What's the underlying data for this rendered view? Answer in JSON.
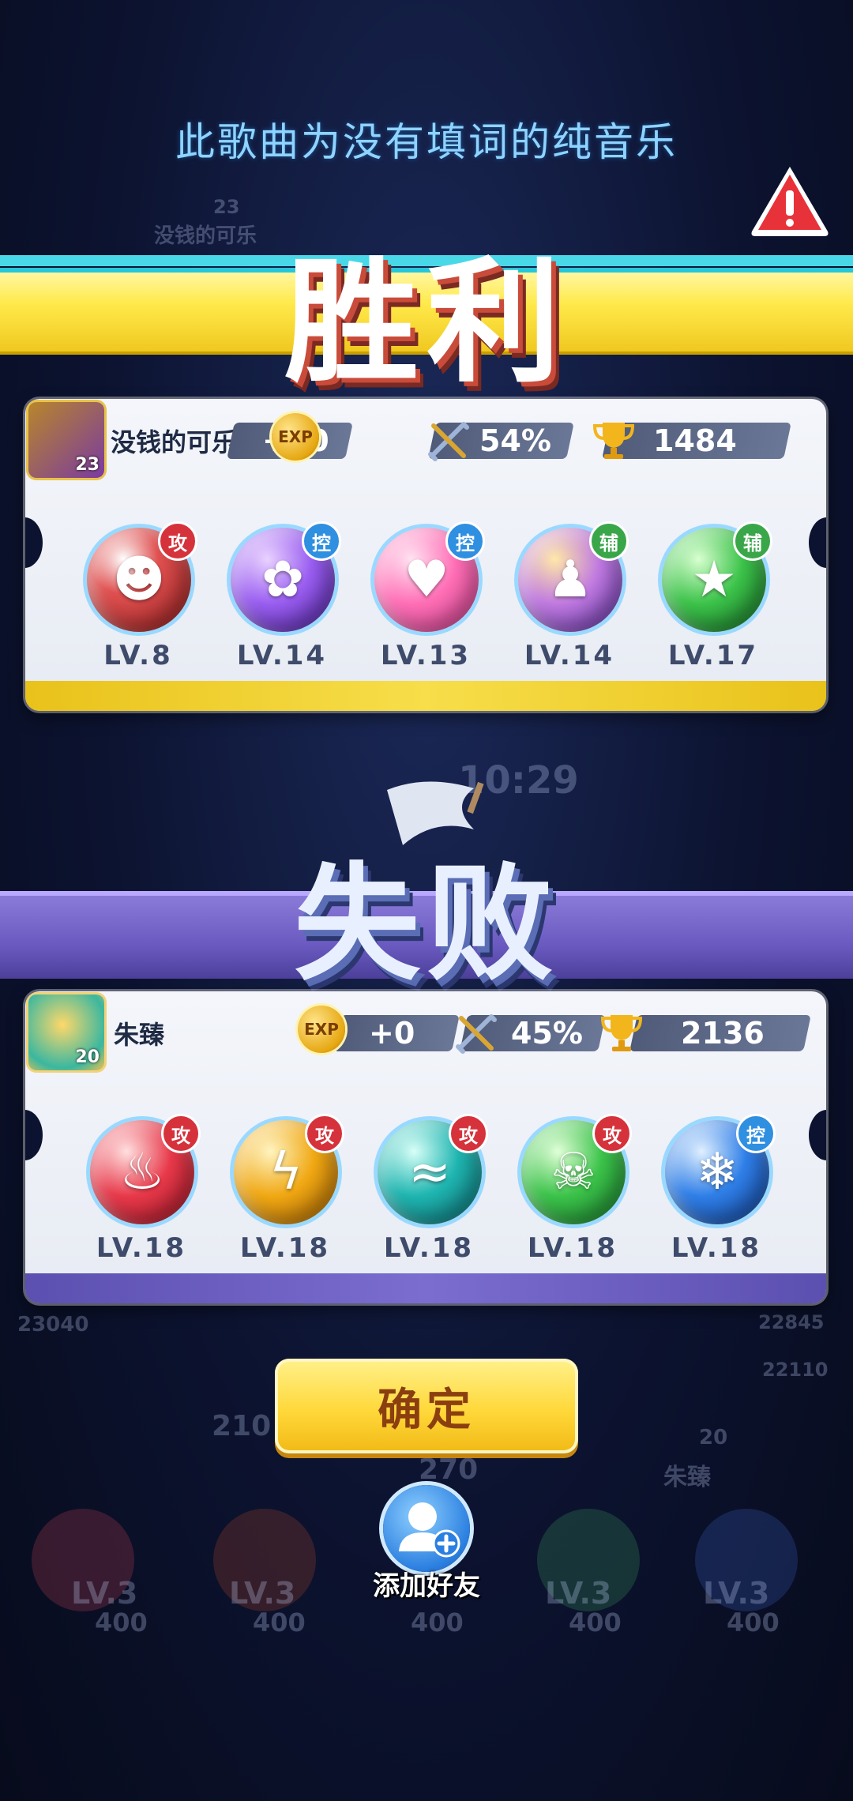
{
  "notice": "此歌曲为没有填词的纯音乐",
  "warning_icon": "warning-icon",
  "win": {
    "title": "胜利",
    "player": {
      "name": "没钱的可乐",
      "level": "23",
      "exp_label": "EXP",
      "exp": "+10",
      "winrate": "54%",
      "trophies": "1484"
    },
    "heroes": [
      {
        "role": "攻",
        "role_type": "atk",
        "level": "LV.8",
        "color": "#d83a3a",
        "icon": "opera-mask-icon"
      },
      {
        "role": "控",
        "role_type": "ctl",
        "level": "LV.14",
        "color": "#8a4fe0",
        "icon": "butterfly-icon"
      },
      {
        "role": "控",
        "role_type": "ctl",
        "level": "LV.13",
        "color": "#ff6fb6",
        "icon": "heart-icon"
      },
      {
        "role": "辅",
        "role_type": "sup",
        "level": "LV.14",
        "color": "#b06ad8",
        "icon": "figures-icon"
      },
      {
        "role": "辅",
        "role_type": "sup",
        "level": "LV.17",
        "color": "#2fae4a",
        "icon": "star-arrow-icon"
      }
    ]
  },
  "lose": {
    "title": "失败",
    "player": {
      "name": "朱臻",
      "level": "20",
      "exp_label": "EXP",
      "exp": "+0",
      "winrate": "45%",
      "trophies": "2136"
    },
    "heroes": [
      {
        "role": "攻",
        "role_type": "atk",
        "level": "LV.18",
        "color": "#e8394a",
        "icon": "fire-icon"
      },
      {
        "role": "攻",
        "role_type": "atk",
        "level": "LV.18",
        "color": "#f0a814",
        "icon": "lightning-icon"
      },
      {
        "role": "攻",
        "role_type": "atk",
        "level": "LV.18",
        "color": "#1fb5b0",
        "icon": "wave-icon"
      },
      {
        "role": "攻",
        "role_type": "atk",
        "level": "LV.18",
        "color": "#3cc34a",
        "icon": "skull-icon"
      },
      {
        "role": "控",
        "role_type": "ctl",
        "level": "LV.18",
        "color": "#2f7fe8",
        "icon": "snowflake-icon"
      }
    ]
  },
  "confirm_label": "确定",
  "add_friend_label": "添加好友",
  "background": {
    "timer": "10:29",
    "ghost_left_score": "23040",
    "ghost_right_scores": [
      "22845",
      "22110"
    ],
    "ghost_name_top": "没钱的可乐",
    "ghost_level_top": "23",
    "ghost_name_bottom": "朱臻",
    "ghost_level_bottom": "20",
    "ghost_sp_values": [
      "210",
      "270"
    ],
    "ghost_lv_labels": [
      "LV.3",
      "LV.3",
      "LV.3",
      "LV.3",
      "LV.3"
    ],
    "ghost_cost": [
      "400",
      "400",
      "400",
      "400",
      "400"
    ]
  }
}
